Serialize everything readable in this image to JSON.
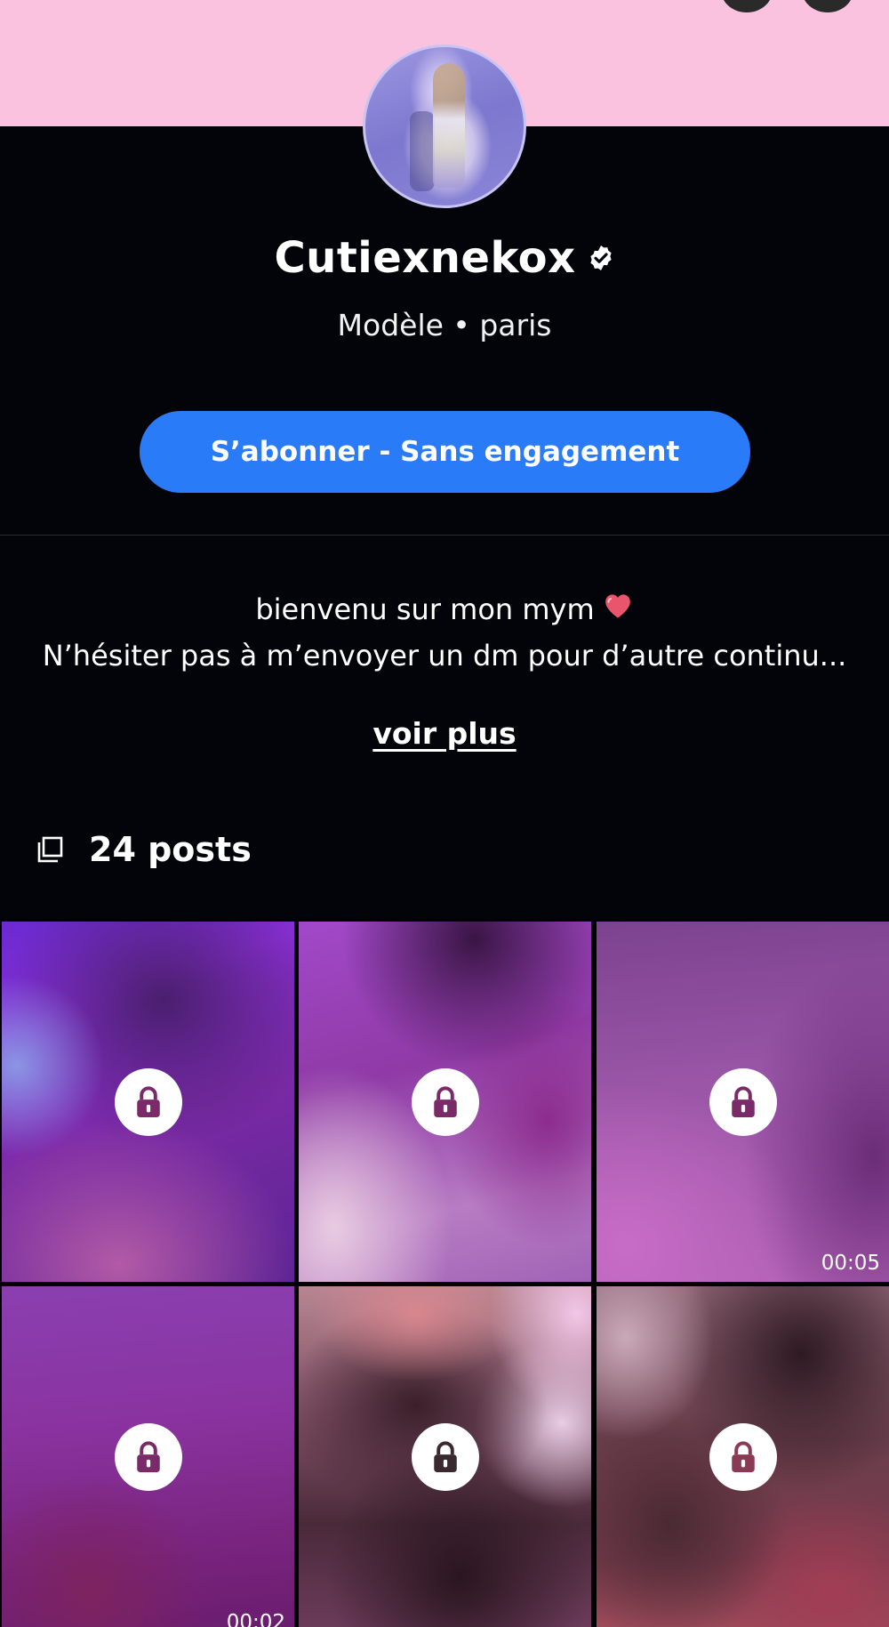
{
  "profile": {
    "name": "Cutiexnekox",
    "subtitle": "Modèle • paris",
    "subscribe_label": "S’abonner - Sans engagement"
  },
  "bio": {
    "line1": "bienvenu sur mon mym",
    "line2": "N’hésiter pas à m’envoyer un dm pour d’autre continu...",
    "more_label": "voir plus"
  },
  "posts": {
    "count_label": "24 posts",
    "tiles": [
      {
        "locked": true,
        "duration": ""
      },
      {
        "locked": true,
        "duration": ""
      },
      {
        "locked": true,
        "duration": "00:05"
      },
      {
        "locked": true,
        "duration": "00:02"
      },
      {
        "locked": true,
        "duration": ""
      },
      {
        "locked": true,
        "duration": ""
      }
    ]
  },
  "colors": {
    "banner": "#fbc2e0",
    "background": "#03040a",
    "accent": "#2a7bf7"
  },
  "icons": [
    "verified-badge-icon",
    "heart-icon",
    "posts-icon",
    "lock-icon"
  ]
}
